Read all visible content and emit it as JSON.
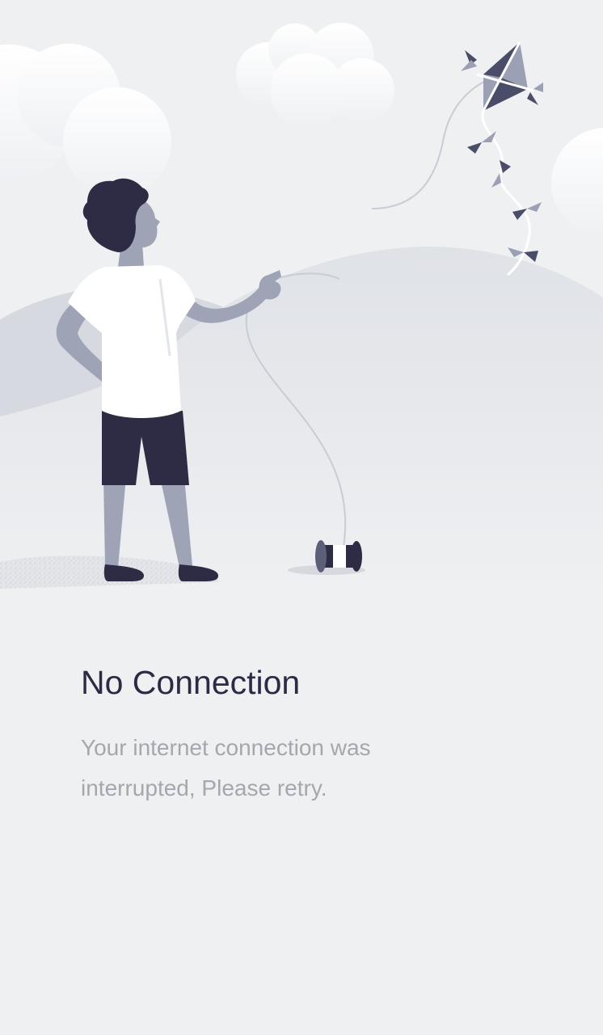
{
  "illustration": {
    "icon": "kite-flying-illustration",
    "colors": {
      "background": "#eff0f2",
      "hill_back": "#d9dce2",
      "hill_front": "#dfe2e7",
      "figure_dark": "#2e2c45",
      "figure_skin": "#9fa3b6",
      "shirt": "#ffffff",
      "kite_dark": "#4a4d68",
      "kite_light": "#9ca0b4"
    }
  },
  "error": {
    "title": "No Connection",
    "message": "Your internet connection was interrupted, Please retry."
  }
}
